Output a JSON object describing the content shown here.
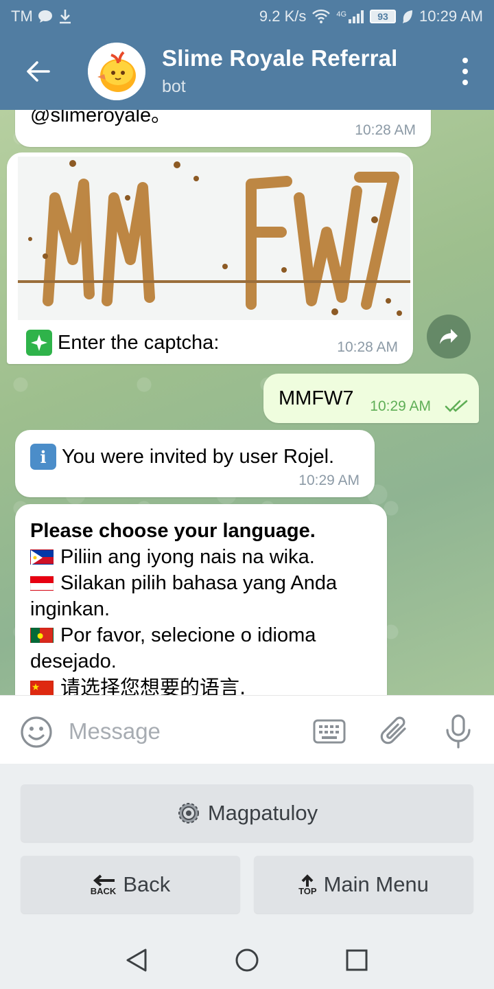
{
  "status_bar": {
    "carrier": "TM",
    "net_speed": "9.2 K/s",
    "network_type": "4G",
    "battery": "93",
    "time": "10:29 AM"
  },
  "header": {
    "title": "Slime Royale Referral",
    "subtitle": "bot"
  },
  "messages": {
    "m1": {
      "text": "@slimeroyale。",
      "time": "10:28 AM"
    },
    "m2": {
      "text": "Enter the captcha:",
      "time": "10:28 AM",
      "captcha_text": "MM FW7"
    },
    "m3": {
      "text": "MMFW7",
      "time": "10:29 AM"
    },
    "m4": {
      "text": "You were invited by user Rojel.",
      "time": "10:29 AM"
    },
    "m5": {
      "title": "Please choose your language.",
      "lines": [
        "Piliin ang iyong nais na wika.",
        "Silakan pilih bahasa yang Anda inginkan.",
        "Por favor, selecione o idioma desejado.",
        "请选择您想要的语言."
      ]
    }
  },
  "input": {
    "placeholder": "Message"
  },
  "keyboard": {
    "continue_label": "Magpatuloy",
    "back_label": "Back",
    "back_icon_text": "BACK",
    "main_menu_label": "Main Menu",
    "top_icon_text": "TOP"
  },
  "colors": {
    "header": "#517da2",
    "outgoing_bubble": "#effdde",
    "chat_bg": "#a9c69a",
    "keyboard_bg": "#eceff1"
  },
  "icons": [
    "back-arrow-icon",
    "more-vert-icon",
    "forward-icon",
    "sparkle-icon",
    "info-icon",
    "double-check-icon",
    "emoji-icon",
    "keyboard-icon",
    "paperclip-icon",
    "mic-icon",
    "gear-icon",
    "nav-back-icon",
    "nav-home-icon",
    "nav-recents-icon"
  ]
}
